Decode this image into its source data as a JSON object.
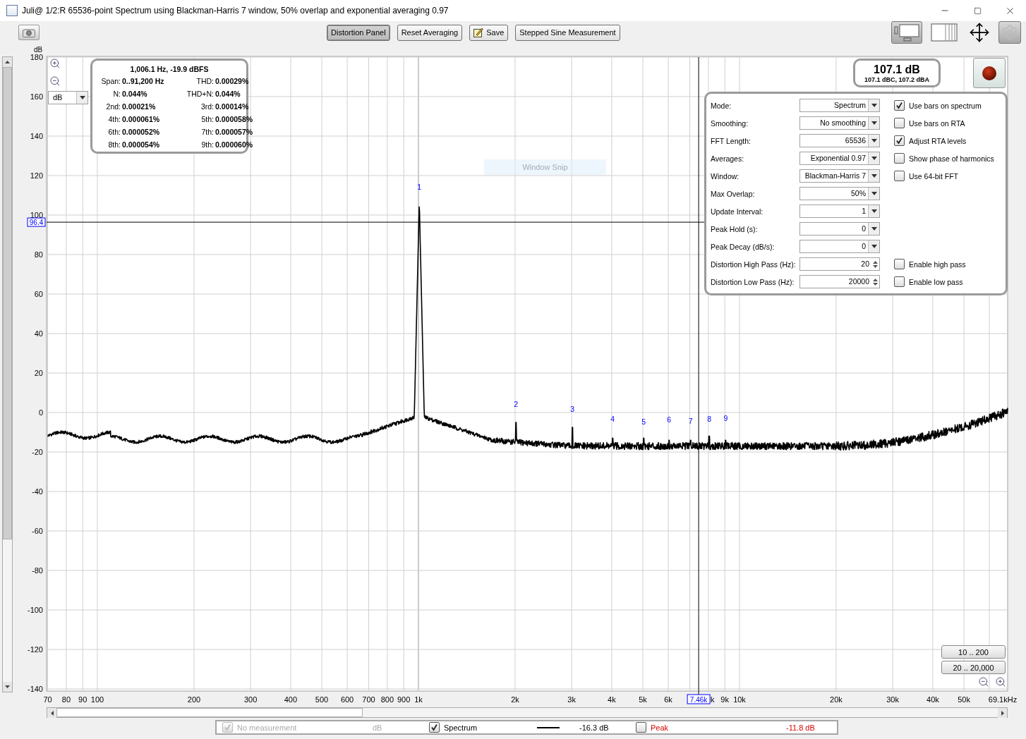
{
  "window": {
    "title": "Juli@ 1/2:R 65536-point Spectrum using Blackman-Harris 7 window, 50% overlap and exponential averaging 0.97"
  },
  "toolbar": {
    "buttons": [
      {
        "label": "Distortion Panel",
        "selected": true,
        "kind": "text"
      },
      {
        "label": "Reset Averaging",
        "selected": false,
        "kind": "text"
      },
      {
        "label": "Save",
        "selected": false,
        "kind": "save"
      },
      {
        "label": "Stepped Sine Measurement",
        "selected": false,
        "kind": "text"
      }
    ],
    "view_buttons": [
      {
        "kind": "layout",
        "selected": true
      },
      {
        "kind": "columns",
        "selected": false
      },
      {
        "kind": "move",
        "selected": false
      },
      {
        "kind": "gear",
        "selected": true
      }
    ]
  },
  "chart": {
    "y_unit": "dB",
    "y_ticks": [
      "180",
      "160",
      "140",
      "120",
      "100",
      "80",
      "60",
      "40",
      "20",
      "0",
      "-20",
      "-40",
      "-60",
      "-80",
      "-100",
      "-120",
      "-140"
    ],
    "x_ticks": [
      "70",
      "80",
      "90",
      "100",
      "200",
      "300",
      "400",
      "500",
      "600",
      "700",
      "800",
      "900",
      "1k",
      "2k",
      "3k",
      "4k",
      "5k",
      "6k",
      "k",
      "9k",
      "10k",
      "20k",
      "30k",
      "40k",
      "50k",
      "69.1kHz"
    ],
    "y_cursor": "96.4",
    "x_cursor": "7.46k",
    "harmonic_markers": [
      "1",
      "2",
      "3",
      "4",
      "5",
      "6",
      "7",
      "8",
      "9"
    ],
    "unit_select": "dB",
    "overlay_label": "Window Snip",
    "range_buttons": [
      "10 .. 200",
      "20 .. 20,000"
    ]
  },
  "distortion_box": {
    "headline": "1,006.1 Hz, -19.9 dBFS",
    "cells": [
      {
        "label": "Span:",
        "value": "0..91,200 Hz"
      },
      {
        "label": "THD:",
        "value": "0.00029%"
      },
      {
        "label": "N:",
        "value": "0.044%"
      },
      {
        "label": "THD+N:",
        "value": "0.044%"
      },
      {
        "label": "2nd:",
        "value": "0.00021%"
      },
      {
        "label": "3rd:",
        "value": "0.00014%"
      },
      {
        "label": "4th:",
        "value": "0.000061%"
      },
      {
        "label": "5th:",
        "value": "0.000058%"
      },
      {
        "label": "6th:",
        "value": "0.000052%"
      },
      {
        "label": "7th:",
        "value": "0.000057%"
      },
      {
        "label": "8th:",
        "value": "0.000054%"
      },
      {
        "label": "9th:",
        "value": "0.000060%"
      }
    ]
  },
  "level_meter": {
    "value": "107.1 dB",
    "detail": "107.1 dBC, 107.2 dBA"
  },
  "settings": [
    {
      "label": "Mode:",
      "value": "Spectrum",
      "kind": "dropdown",
      "option": {
        "label": "Use bars on spectrum",
        "checked": true
      }
    },
    {
      "label": "Smoothing:",
      "value": "No  smoothing",
      "kind": "dropdown",
      "option": {
        "label": "Use bars on RTA",
        "checked": false
      }
    },
    {
      "label": "FFT Length:",
      "value": "65536",
      "kind": "dropdown",
      "option": {
        "label": "Adjust RTA levels",
        "checked": true
      }
    },
    {
      "label": "Averages:",
      "value": "Exponential 0.97",
      "kind": "dropdown",
      "option": {
        "label": "Show phase of harmonics",
        "checked": false
      }
    },
    {
      "label": "Window:",
      "value": "Blackman-Harris 7",
      "kind": "dropdown",
      "option": {
        "label": "Use 64-bit FFT",
        "checked": false
      }
    },
    {
      "label": "Max Overlap:",
      "value": "50%",
      "kind": "dropdown"
    },
    {
      "label": "Update Interval:",
      "value": "1",
      "kind": "dropdown"
    },
    {
      "label": "Peak Hold (s):",
      "value": "0",
      "kind": "dropdown"
    },
    {
      "label": "Peak Decay (dB/s):",
      "value": "0",
      "kind": "dropdown"
    },
    {
      "label": "Distortion High Pass (Hz):",
      "value": "20",
      "kind": "spinner",
      "option": {
        "label": "Enable high pass",
        "checked": false
      }
    },
    {
      "label": "Distortion Low Pass (Hz):",
      "value": "20000",
      "kind": "spinner",
      "option": {
        "label": "Enable low pass",
        "checked": false
      }
    }
  ],
  "legend": [
    {
      "label": "No measurement",
      "checked": true,
      "disabled": true,
      "kind": "plain",
      "reading": "dB"
    },
    {
      "label": "Spectrum",
      "checked": true,
      "disabled": false,
      "kind": "line",
      "color": "#000000",
      "reading": "-16.3 dB"
    },
    {
      "label": "Peak",
      "checked": false,
      "disabled": false,
      "kind": "text",
      "color": "#d40000",
      "reading": "-11.8 dB"
    }
  ]
}
